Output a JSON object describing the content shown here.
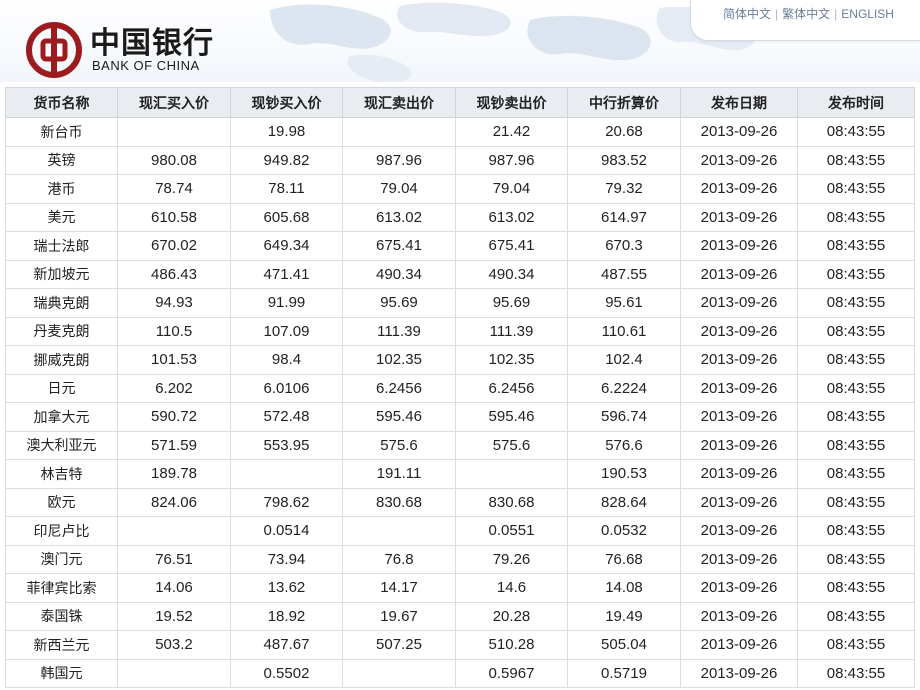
{
  "brand": {
    "name_cn": "中国银行",
    "name_en": "BANK OF CHINA",
    "color": "#9b1b1f"
  },
  "lang_links": [
    "简体中文",
    "繁体中文",
    "ENGLISH"
  ],
  "table": {
    "headers": [
      "货币名称",
      "现汇买入价",
      "现钞买入价",
      "现汇卖出价",
      "现钞卖出价",
      "中行折算价",
      "发布日期",
      "发布时间"
    ],
    "rows": [
      [
        "新台币",
        "",
        "19.98",
        "",
        "21.42",
        "20.68",
        "2013-09-26",
        "08:43:55"
      ],
      [
        "英镑",
        "980.08",
        "949.82",
        "987.96",
        "987.96",
        "983.52",
        "2013-09-26",
        "08:43:55"
      ],
      [
        "港币",
        "78.74",
        "78.11",
        "79.04",
        "79.04",
        "79.32",
        "2013-09-26",
        "08:43:55"
      ],
      [
        "美元",
        "610.58",
        "605.68",
        "613.02",
        "613.02",
        "614.97",
        "2013-09-26",
        "08:43:55"
      ],
      [
        "瑞士法郎",
        "670.02",
        "649.34",
        "675.41",
        "675.41",
        "670.3",
        "2013-09-26",
        "08:43:55"
      ],
      [
        "新加坡元",
        "486.43",
        "471.41",
        "490.34",
        "490.34",
        "487.55",
        "2013-09-26",
        "08:43:55"
      ],
      [
        "瑞典克朗",
        "94.93",
        "91.99",
        "95.69",
        "95.69",
        "95.61",
        "2013-09-26",
        "08:43:55"
      ],
      [
        "丹麦克朗",
        "110.5",
        "107.09",
        "111.39",
        "111.39",
        "110.61",
        "2013-09-26",
        "08:43:55"
      ],
      [
        "挪威克朗",
        "101.53",
        "98.4",
        "102.35",
        "102.35",
        "102.4",
        "2013-09-26",
        "08:43:55"
      ],
      [
        "日元",
        "6.202",
        "6.0106",
        "6.2456",
        "6.2456",
        "6.2224",
        "2013-09-26",
        "08:43:55"
      ],
      [
        "加拿大元",
        "590.72",
        "572.48",
        "595.46",
        "595.46",
        "596.74",
        "2013-09-26",
        "08:43:55"
      ],
      [
        "澳大利亚元",
        "571.59",
        "553.95",
        "575.6",
        "575.6",
        "576.6",
        "2013-09-26",
        "08:43:55"
      ],
      [
        "林吉特",
        "189.78",
        "",
        "191.11",
        "",
        "190.53",
        "2013-09-26",
        "08:43:55"
      ],
      [
        "欧元",
        "824.06",
        "798.62",
        "830.68",
        "830.68",
        "828.64",
        "2013-09-26",
        "08:43:55"
      ],
      [
        "印尼卢比",
        "",
        "0.0514",
        "",
        "0.0551",
        "0.0532",
        "2013-09-26",
        "08:43:55"
      ],
      [
        "澳门元",
        "76.51",
        "73.94",
        "76.8",
        "79.26",
        "76.68",
        "2013-09-26",
        "08:43:55"
      ],
      [
        "菲律宾比索",
        "14.06",
        "13.62",
        "14.17",
        "14.6",
        "14.08",
        "2013-09-26",
        "08:43:55"
      ],
      [
        "泰国铢",
        "19.52",
        "18.92",
        "19.67",
        "20.28",
        "19.49",
        "2013-09-26",
        "08:43:55"
      ],
      [
        "新西兰元",
        "503.2",
        "487.67",
        "507.25",
        "510.28",
        "505.04",
        "2013-09-26",
        "08:43:55"
      ],
      [
        "韩国元",
        "",
        "0.5502",
        "",
        "0.5967",
        "0.5719",
        "2013-09-26",
        "08:43:55"
      ]
    ]
  }
}
